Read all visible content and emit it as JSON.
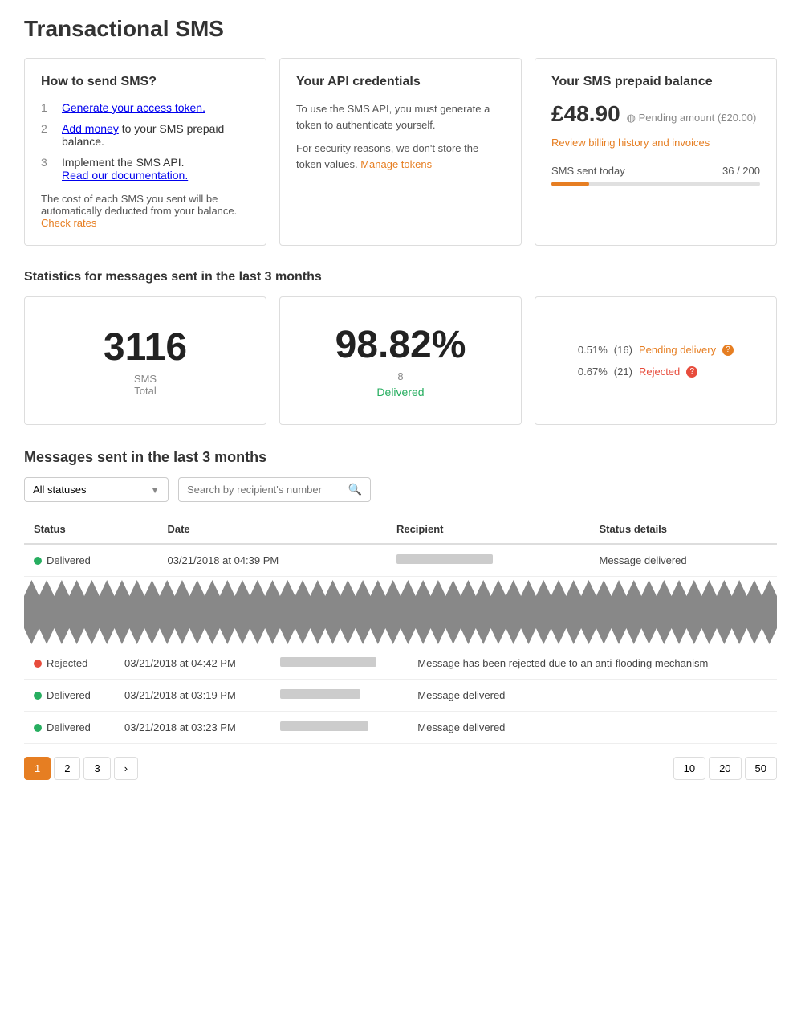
{
  "page": {
    "title": "Transactional SMS"
  },
  "how_to_send": {
    "card_title": "How to send SMS?",
    "steps": [
      {
        "num": "1",
        "text": "Generate your access token.",
        "link": true
      },
      {
        "num": "2",
        "text_prefix": "Add money",
        "text_suffix": " to your SMS prepaid balance.",
        "link": true
      },
      {
        "num": "3",
        "text_prefix": "Implement the SMS API.",
        "text_link": "Read our documentation.",
        "link": true
      }
    ],
    "footer": "The cost of each SMS you sent will be automatically deducted from your balance.",
    "footer_link": "Check rates"
  },
  "api_creds": {
    "card_title": "Your API credentials",
    "para1": "To use the SMS API, you must generate a token to authenticate yourself.",
    "para2": "For security reasons, we don't store the token values.",
    "manage_tokens_link": "Manage tokens"
  },
  "balance": {
    "card_title": "Your SMS prepaid balance",
    "amount": "£48.90",
    "pending_label": "Pending amount (£20.00)",
    "review_link": "Review billing history and invoices",
    "sms_today_label": "SMS sent today",
    "sms_today_value": "36 / 200",
    "progress_percent": 18
  },
  "stats": {
    "section_title": "Statistics for messages sent in the last 3 months",
    "total_number": "3116",
    "total_label": "SMS",
    "total_sublabel": "Total",
    "delivered_percent": "98.82%",
    "delivered_count": "8",
    "delivered_label": "Delivered",
    "pending_pct": "0.51%",
    "pending_count": "16",
    "pending_label": "Pending delivery",
    "rejected_pct": "0.67%",
    "rejected_count": "21",
    "rejected_label": "Rejected"
  },
  "messages": {
    "section_title": "Messages sent in the last 3 months",
    "filter_placeholder": "All statuses",
    "search_placeholder": "Search by recipient's number",
    "columns": [
      "Status",
      "Date",
      "Recipient",
      "Status details"
    ],
    "rows": [
      {
        "status": "Delivered",
        "status_type": "delivered",
        "date": "03/21/2018 at 04:39 PM",
        "recipient_redacted": true,
        "recipient_width": 120,
        "details": "Message delivered"
      },
      {
        "status": "Rejected",
        "status_type": "rejected",
        "date": "03/21/2018 at 04:42 PM",
        "recipient_redacted": true,
        "recipient_width": 120,
        "details": "Message has been rejected due to an anti-flooding mechanism"
      },
      {
        "status": "Delivered",
        "status_type": "delivered",
        "date": "03/21/2018 at 03:19 PM",
        "recipient_redacted": true,
        "recipient_width": 100,
        "details": "Message delivered"
      },
      {
        "status": "Delivered",
        "status_type": "delivered",
        "date": "03/21/2018 at 03:23 PM",
        "recipient_redacted": true,
        "recipient_width": 110,
        "details": "Message delivered"
      }
    ]
  },
  "pagination": {
    "pages": [
      "1",
      "2",
      "3"
    ],
    "active_page": "1",
    "next_label": "›",
    "page_sizes": [
      "10",
      "20",
      "50"
    ]
  },
  "colors": {
    "accent": "#e67e22",
    "green": "#27ae60",
    "red": "#e74c3c",
    "grey": "#888"
  }
}
